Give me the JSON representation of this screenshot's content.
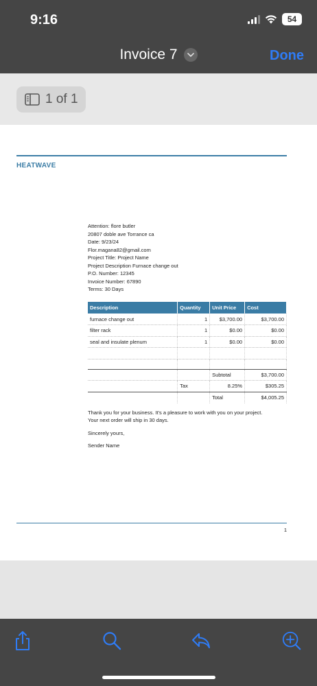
{
  "status_bar": {
    "time": "9:16",
    "battery": "54"
  },
  "nav": {
    "title": "Invoice 7",
    "done_label": "Done"
  },
  "pager": {
    "label": "1 of 1"
  },
  "document": {
    "company": "HEATWAVE",
    "address_lines": [
      "Attention: flore butler",
      "20807 doble ave Torrance ca",
      "Date: 9/23/24",
      "Flor.magana82@gmail.com",
      "Project Title: Project Name",
      "Project Description Furnace change out",
      "P.O. Number: 12345",
      "Invoice Number: 67890",
      "Terms: 30 Days"
    ],
    "table": {
      "headers": [
        "Description",
        "Quantity",
        "Unit Price",
        "Cost"
      ],
      "rows": [
        [
          "furnace change out",
          "1",
          "$3,700.00",
          "$3,700.00"
        ],
        [
          "filter rack",
          "1",
          "$0.00",
          "$0.00"
        ],
        [
          "seal and insulate plenum",
          "1",
          "$0.00",
          "$0.00"
        ]
      ],
      "subtotal_label": "Subtotal",
      "subtotal_value": "$3,700.00",
      "tax_label": "Tax",
      "tax_rate": "8.25%",
      "tax_value": "$305.25",
      "total_label": "Total",
      "total_value": "$4,005.25"
    },
    "thank_you_1": "Thank you for your business. It's a pleasure to work with you on your project.",
    "thank_you_2": "Your next order will ship in 30 days.",
    "sincerely": "Sincerely yours,",
    "sender": "Sender Name",
    "page_number": "1"
  },
  "toolbar": {
    "icons": [
      "share-icon",
      "search-icon",
      "reply-icon",
      "zoom-in-icon"
    ]
  },
  "colors": {
    "accent": "#2f7cf6",
    "doc_blue": "#3a7ca5",
    "bar_bg": "#454545"
  }
}
